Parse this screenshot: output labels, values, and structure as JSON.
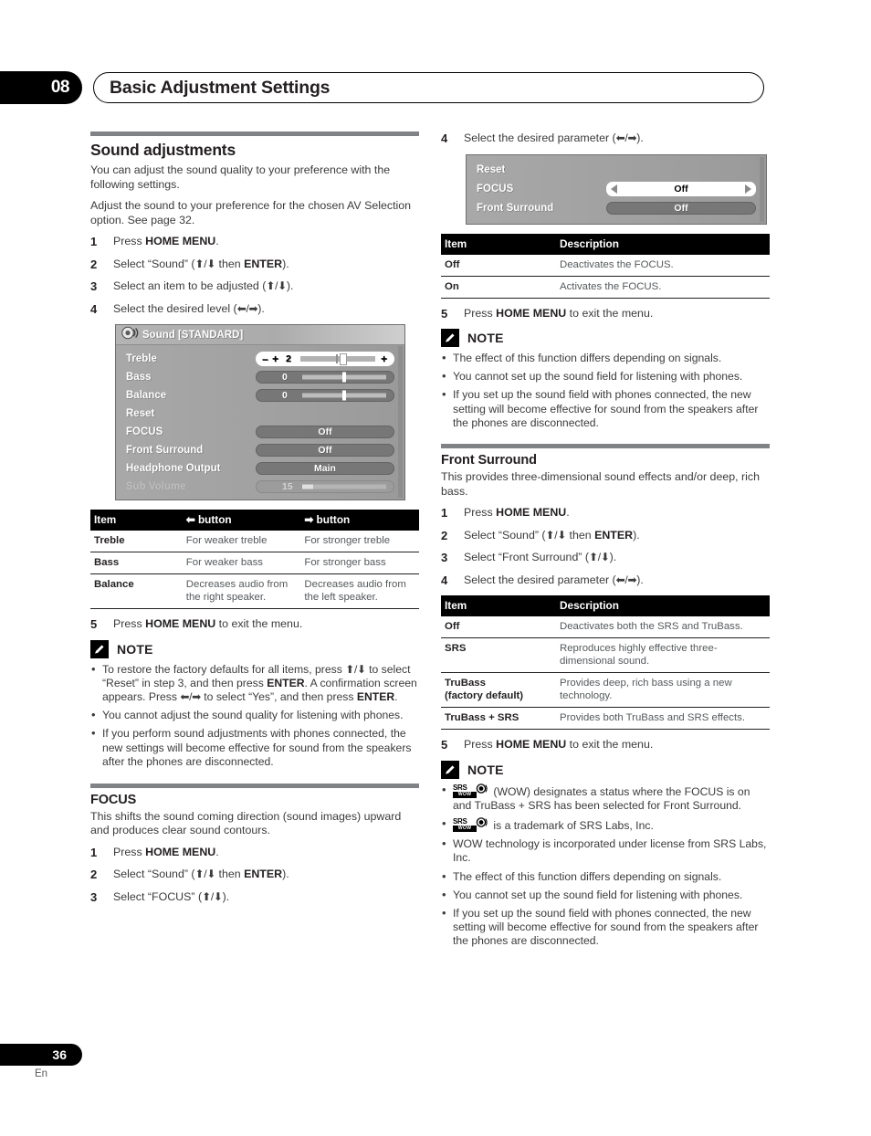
{
  "header": {
    "chapter_number": "08",
    "chapter_title": "Basic Adjustment Settings"
  },
  "footer": {
    "page_number": "36",
    "language_code": "En"
  },
  "left_column": {
    "section": {
      "title": "Sound adjustments",
      "intro1": "You can adjust the sound quality to your preference with the following settings.",
      "intro2": "Adjust the sound to your preference for the chosen AV Selection option. See page 32."
    },
    "steps": [
      {
        "num": "1",
        "html": "Press <b>HOME MENU</b>."
      },
      {
        "num": "2",
        "html": "Select “Sound” (<span class=\"arw\">⬆/⬇</span> then <b>ENTER</b>)."
      },
      {
        "num": "3",
        "html": "Select an item to be adjusted (<span class=\"arw\">⬆/⬇</span>)."
      },
      {
        "num": "4",
        "html": "Select the desired level (<span class=\"arw\">⬅/➡</span>)."
      }
    ],
    "osd": {
      "title": "Sound [STANDARD]",
      "rows": [
        {
          "name": "Treble",
          "value": "2",
          "type": "treble-slider"
        },
        {
          "name": "Bass",
          "value": "0",
          "type": "slider"
        },
        {
          "name": "Balance",
          "value": "0",
          "type": "slider"
        },
        {
          "name": "Reset",
          "value": "",
          "type": "none"
        },
        {
          "name": "FOCUS",
          "value": "Off",
          "type": "pill"
        },
        {
          "name": "Front Surround",
          "value": "Off",
          "type": "pill"
        },
        {
          "name": "Headphone Output",
          "value": "Main",
          "type": "pill"
        },
        {
          "name": "Sub Volume",
          "value": "15",
          "type": "slider-dim"
        }
      ]
    },
    "table": {
      "headers": [
        "Item",
        "⬅ button",
        "➡ button"
      ],
      "rows": [
        [
          "Treble",
          "For weaker treble",
          "For stronger treble"
        ],
        [
          "Bass",
          "For weaker bass",
          "For stronger bass"
        ],
        [
          "Balance",
          "Decreases audio from the right speaker.",
          "Decreases audio from the left speaker."
        ]
      ]
    },
    "step5": {
      "num": "5",
      "html": "Press <b>HOME MENU</b> to exit the menu."
    },
    "note": {
      "title": "NOTE",
      "items": [
        "To restore the factory defaults for all items, press <span class=\"arw\">⬆/⬇</span> to select “Reset” in step 3, and then press <b>ENTER</b>. A confirmation screen appears. Press <span class=\"arw\">⬅/➡</span> to select “Yes”, and then press <b>ENTER</b>.",
        "You cannot adjust the sound quality for listening with phones.",
        "If you perform sound adjustments with phones connected, the new settings will become effective for sound from the speakers after the phones are disconnected."
      ]
    },
    "focus": {
      "title": "FOCUS",
      "intro": "This shifts the sound coming direction (sound images) upward and produces clear sound contours.",
      "steps": [
        {
          "num": "1",
          "html": "Press <b>HOME MENU</b>."
        },
        {
          "num": "2",
          "html": "Select “Sound” (<span class=\"arw\">⬆/⬇</span> then <b>ENTER</b>)."
        },
        {
          "num": "3",
          "html": "Select “FOCUS” (<span class=\"arw\">⬆/⬇</span>)."
        }
      ]
    }
  },
  "right_column": {
    "step4": {
      "num": "4",
      "html": "Select the desired parameter (<span class=\"arw\">⬅/➡</span>)."
    },
    "osd": {
      "rows": [
        {
          "name": "Reset",
          "value": "",
          "type": "none"
        },
        {
          "name": "FOCUS",
          "value": "Off",
          "type": "pill-selected"
        },
        {
          "name": "Front Surround",
          "value": "Off",
          "type": "pill"
        }
      ]
    },
    "focus_table": {
      "headers": [
        "Item",
        "Description"
      ],
      "rows": [
        [
          "Off",
          "Deactivates the FOCUS."
        ],
        [
          "On",
          "Activates the FOCUS."
        ]
      ]
    },
    "step5": {
      "num": "5",
      "html": "Press <b>HOME MENU</b> to exit the menu."
    },
    "note1": {
      "title": "NOTE",
      "items": [
        "The effect of this function differs depending on signals.",
        "You cannot set up the sound field for listening with phones.",
        "If you set up the sound field with phones connected, the new setting will become effective for sound from the speakers after the phones are disconnected."
      ]
    },
    "front_surround": {
      "title": "Front Surround",
      "intro": "This provides three-dimensional sound effects and/or deep, rich bass.",
      "steps": [
        {
          "num": "1",
          "html": "Press <b>HOME MENU</b>."
        },
        {
          "num": "2",
          "html": "Select “Sound” (<span class=\"arw\">⬆/⬇</span> then <b>ENTER</b>)."
        },
        {
          "num": "3",
          "html": "Select “Front Surround” (<span class=\"arw\">⬆/⬇</span>)."
        },
        {
          "num": "4",
          "html": "Select the desired parameter (<span class=\"arw\">⬅/➡</span>)."
        }
      ]
    },
    "surround_table": {
      "headers": [
        "Item",
        "Description"
      ],
      "rows": [
        [
          "Off",
          "Deactivates both the SRS and TruBass."
        ],
        [
          "SRS",
          "Reproduces highly effective three-dimensional sound."
        ],
        [
          "TruBass\n(factory default)",
          "Provides deep, rich bass using a new technology."
        ],
        [
          "TruBass + SRS",
          "Provides both TruBass and SRS effects."
        ]
      ]
    },
    "step5b": {
      "num": "5",
      "html": "Press <b>HOME MENU</b> to exit the menu."
    },
    "note2": {
      "title": "NOTE",
      "items": [
        "__SRSLOGO__ (WOW) designates a status where the FOCUS is on and TruBass + SRS has been selected for Front Surround.",
        "__SRSLOGO__ is a trademark of SRS Labs, Inc.",
        "WOW technology is incorporated under license from SRS Labs, Inc.",
        "The effect of this function differs depending on signals.",
        "You cannot set up the sound field for listening with phones.",
        "If you set up the sound field with phones connected, the new setting will become effective for sound from the speakers after the phones are disconnected."
      ]
    },
    "srs_logo": {
      "brand": "SRS",
      "sub": "WOW"
    }
  }
}
